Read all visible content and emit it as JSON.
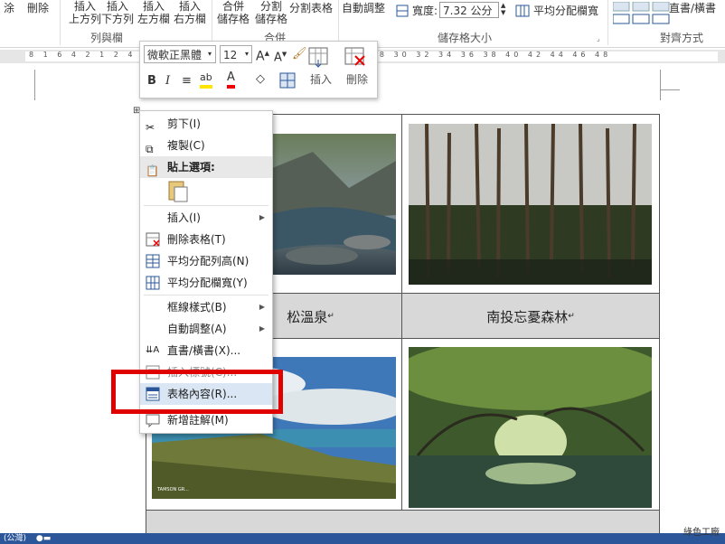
{
  "ribbon": {
    "buttons": {
      "delete": "刪除",
      "insert_above": [
        "插入",
        "上方列"
      ],
      "insert_below": [
        "插入",
        "下方列"
      ],
      "insert_left": [
        "插入",
        "左方欄"
      ],
      "insert_right": [
        "插入",
        "右方欄"
      ],
      "merge_cells": [
        "合併",
        "儲存格"
      ],
      "split_cells": [
        "分割",
        "儲存格"
      ],
      "split_table": "分割表格",
      "autofit": "自動調整",
      "width_label": "寬度:",
      "width_value": "7.32 公分",
      "distribute_columns": "平均分配欄寬",
      "text_direction": "直書/橫書"
    },
    "groups": {
      "rows_columns": "列與欄",
      "merge": "合併",
      "cell_size": "儲存格大小",
      "alignment": "對齊方式"
    }
  },
  "mini_toolbar": {
    "font": "微軟正黑體",
    "size": "12",
    "insert_label": "插入",
    "delete_label": "刪除"
  },
  "context_menu": {
    "items": [
      {
        "label": "剪下(I)",
        "icon": "scissors-icon"
      },
      {
        "label": "複製(C)",
        "icon": "copy-icon"
      },
      {
        "label": "貼上選項:",
        "icon": "clipboard-icon"
      },
      {
        "label": "插入(I)",
        "icon": "",
        "submenu": true
      },
      {
        "label": "刪除表格(T)",
        "icon": "delete-table-icon"
      },
      {
        "label": "平均分配列高(N)",
        "icon": "distribute-rows-icon"
      },
      {
        "label": "平均分配欄寬(Y)",
        "icon": "distribute-columns-icon"
      },
      {
        "label": "框線樣式(B)",
        "icon": "",
        "submenu": true
      },
      {
        "label": "自動調整(A)",
        "icon": "",
        "submenu": true
      },
      {
        "label": "直書/橫書(X)...",
        "icon": "text-direction-icon"
      },
      {
        "label": "插入標號(C)...",
        "icon": "caption-icon"
      },
      {
        "label": "表格內容(R)...",
        "icon": "table-properties-icon"
      },
      {
        "label": "新增註解(M)",
        "icon": "comment-icon"
      }
    ]
  },
  "document": {
    "captions": [
      "松溫泉",
      "南投忘憂森林"
    ],
    "photo_credit": "TAMSON GR..."
  },
  "status_bar": {
    "lang": "(公灣)"
  },
  "watermark": "綠色工廠"
}
